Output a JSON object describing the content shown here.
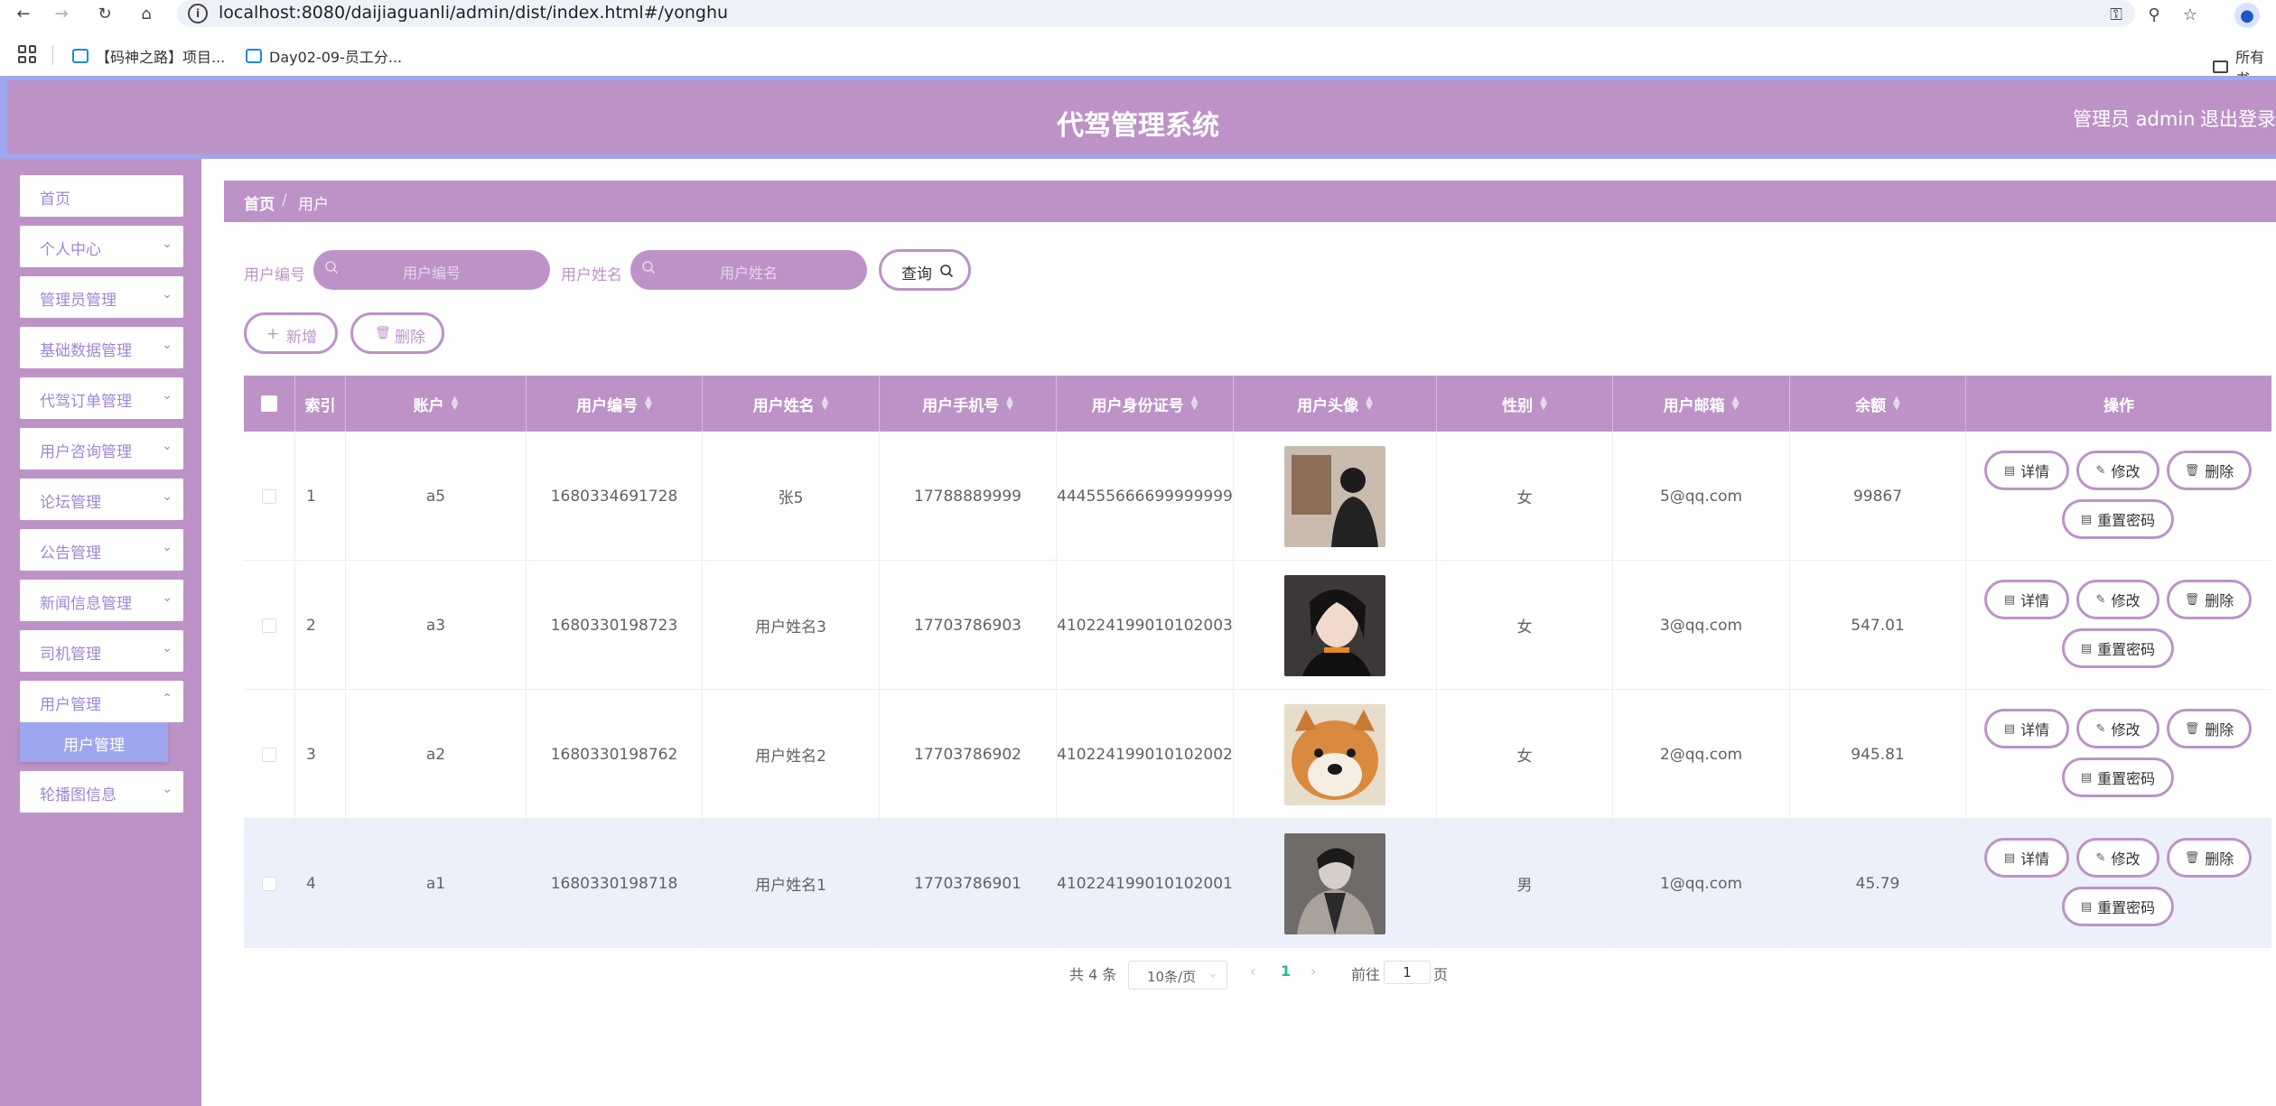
{
  "browser": {
    "url": "localhost:8080/daijiaguanli/admin/dist/index.html#/yonghu",
    "bookmarks": [
      "【码神之路】项目...",
      "Day02-09-员工分...",
      "所有书"
    ]
  },
  "header": {
    "title": "代驾管理系统",
    "admin": "管理员 admin",
    "logout": "退出登录"
  },
  "sidebar": {
    "items": [
      {
        "label": "首页"
      },
      {
        "label": "个人中心"
      },
      {
        "label": "管理员管理"
      },
      {
        "label": "基础数据管理"
      },
      {
        "label": "代驾订单管理"
      },
      {
        "label": "用户咨询管理"
      },
      {
        "label": "论坛管理"
      },
      {
        "label": "公告管理"
      },
      {
        "label": "新闻信息管理"
      },
      {
        "label": "司机管理"
      },
      {
        "label": "用户管理"
      },
      {
        "label": "轮播图信息"
      }
    ],
    "submenu": {
      "label": "用户管理"
    }
  },
  "breadcrumb": {
    "home": "首页",
    "separator": "/",
    "current": "用户"
  },
  "search": {
    "field1_label": "用户编号",
    "field1_placeholder": "用户编号",
    "field2_label": "用户姓名",
    "field2_placeholder": "用户姓名",
    "query": "查询"
  },
  "actions": {
    "add": "新增",
    "delete": "删除"
  },
  "table": {
    "headers": [
      "索引",
      "账户",
      "用户编号",
      "用户姓名",
      "用户手机号",
      "用户身份证号",
      "用户头像",
      "性别",
      "用户邮箱",
      "余额",
      "操作"
    ],
    "rows": [
      {
        "index": "1",
        "account": "a5",
        "number": "1680334691728",
        "name": "张5",
        "phone": "17788889999",
        "idcard": "444555666699999999",
        "gender": "女",
        "email": "5@qq.com",
        "balance": "99867"
      },
      {
        "index": "2",
        "account": "a3",
        "number": "1680330198723",
        "name": "用户姓名3",
        "phone": "17703786903",
        "idcard": "410224199010102003",
        "gender": "女",
        "email": "3@qq.com",
        "balance": "547.01"
      },
      {
        "index": "3",
        "account": "a2",
        "number": "1680330198762",
        "name": "用户姓名2",
        "phone": "17703786902",
        "idcard": "410224199010102002",
        "gender": "女",
        "email": "2@qq.com",
        "balance": "945.81"
      },
      {
        "index": "4",
        "account": "a1",
        "number": "1680330198718",
        "name": "用户姓名1",
        "phone": "17703786901",
        "idcard": "410224199010102001",
        "gender": "男",
        "email": "1@qq.com",
        "balance": "45.79"
      }
    ],
    "ops": {
      "detail": "详情",
      "edit": "修改",
      "delete": "删除",
      "reset": "重置密码"
    }
  },
  "pagination": {
    "total": "共 4 条",
    "page_size": "10条/页",
    "current": "1",
    "goto_prefix": "前往",
    "goto_value": "1",
    "goto_suffix": "页"
  },
  "colors": {
    "primary": "#bd93c7",
    "header_border": "#9ea7ee",
    "submenu": "#9ea7ee",
    "menu_text": "#9e86d6"
  }
}
